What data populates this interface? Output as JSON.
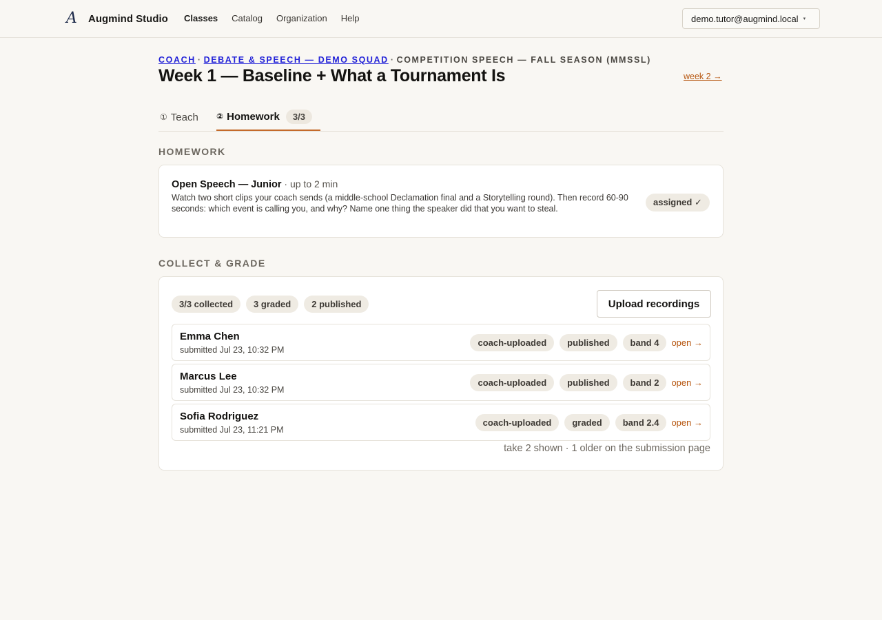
{
  "app": {
    "logo_glyph": "A",
    "name": "Augmind Studio"
  },
  "nav": {
    "items": [
      {
        "label": "Classes",
        "active": true
      },
      {
        "label": "Catalog",
        "active": false
      },
      {
        "label": "Organization",
        "active": false
      },
      {
        "label": "Help",
        "active": false
      }
    ],
    "user_email": "demo.tutor@augmind.local",
    "user_caret": "▾"
  },
  "breadcrumb": {
    "items": [
      "COACH",
      "DEBATE & SPEECH — DEMO SQUAD"
    ],
    "separator": "·",
    "current": "COMPETITION SPEECH — FALL SEASON (MMSSL)"
  },
  "page": {
    "title": "Week 1 — Baseline + What a Tournament Is",
    "next_link": "week 2 →"
  },
  "tabs": {
    "teach": {
      "icon": "①",
      "label": "Teach"
    },
    "homework": {
      "icon": "②",
      "label": "Homework",
      "count": "3/3",
      "active": true
    }
  },
  "homework": {
    "section_label": "HOMEWORK",
    "title": "Open Speech — Junior",
    "meta": " · up to 2 min",
    "description": "Watch two short clips your coach sends (a middle-school Declamation final and a Storytelling round). Then record 60-90 seconds: which event is calling you, and why? Name one thing the speaker did that you want to steal.",
    "status": "assigned ✓"
  },
  "grading": {
    "section_label": "COLLECT & GRADE",
    "stats": [
      "3/3 collected",
      "3 graded",
      "2 published"
    ],
    "upload_label": "Upload recordings",
    "rows": [
      {
        "name": "Emma Chen",
        "submitted": "submitted Jul 23, 10:32 PM",
        "tags": [
          "coach-uploaded",
          "published",
          "band 4"
        ],
        "open": "open →"
      },
      {
        "name": "Marcus Lee",
        "submitted": "submitted Jul 23, 10:32 PM",
        "tags": [
          "coach-uploaded",
          "published",
          "band 2"
        ],
        "open": "open →"
      },
      {
        "name": "Sofia Rodriguez",
        "submitted": "submitted Jul 23, 11:21 PM",
        "tags": [
          "coach-uploaded",
          "graded",
          "band 2.4"
        ],
        "open": "open →"
      }
    ],
    "footnote": "take 2 shown · 1 older on the submission page"
  },
  "colors": {
    "background": "#f9f7f3",
    "accent": "#b6560f",
    "link": "#2323d8",
    "pill": "#efebe3"
  }
}
